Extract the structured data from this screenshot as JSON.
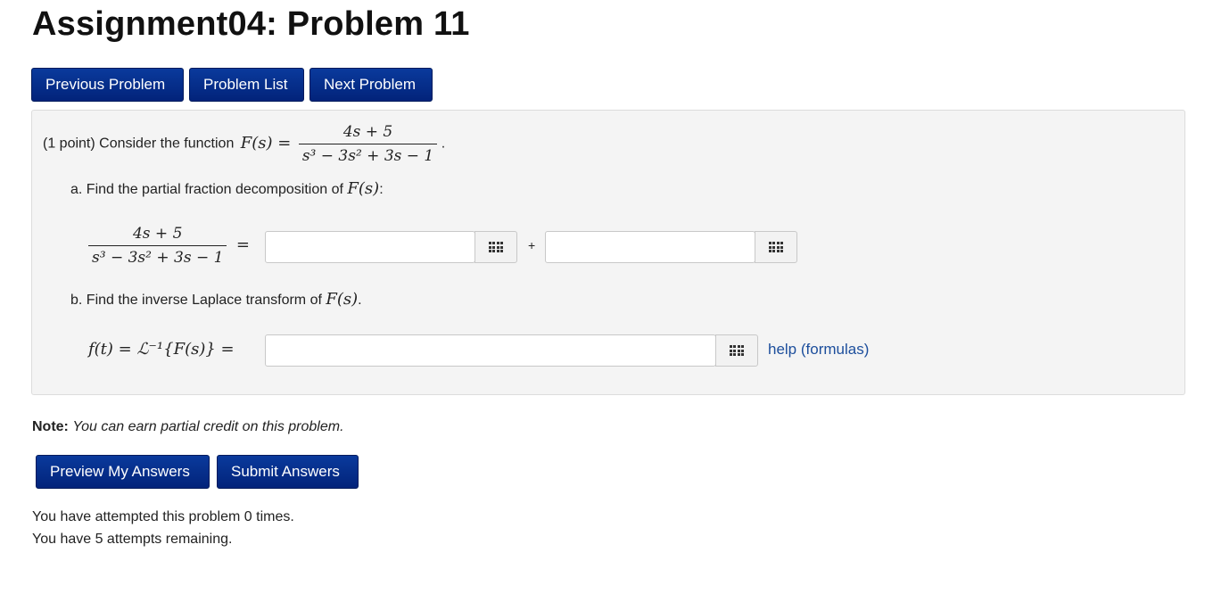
{
  "page": {
    "title": "Assignment04: Problem 11"
  },
  "nav": {
    "previous": "Previous Problem",
    "list": "Problem List",
    "next": "Next Problem"
  },
  "problem": {
    "points": "(1 point) Consider the function",
    "function_lhs": "F(s) =",
    "numerator": "4s + 5",
    "denominator": "s³ − 3s² + 3s − 1",
    "period": ".",
    "part_a": {
      "label": "a. Find the partial fraction decomposition of",
      "symbol": "F(s)",
      "suffix": ":",
      "equals": "=",
      "plus": "+"
    },
    "part_b": {
      "label": "b. Find the inverse Laplace transform of",
      "symbol": "F(s)",
      "suffix": ".",
      "lhs": "f(t) = ℒ⁻¹{F(s)} ="
    },
    "help_link": "help (formulas)"
  },
  "note": {
    "label": "Note:",
    "text": "You can earn partial credit on this problem."
  },
  "actions": {
    "preview": "Preview My Answers",
    "submit": "Submit Answers"
  },
  "status": {
    "attempted": "You have attempted this problem 0 times.",
    "remaining": "You have 5 attempts remaining."
  },
  "icons": {
    "equation_editor": "grid-icon"
  },
  "colors": {
    "button": "#02237a",
    "link": "#1c4e9c",
    "panel": "#f4f4f4"
  }
}
